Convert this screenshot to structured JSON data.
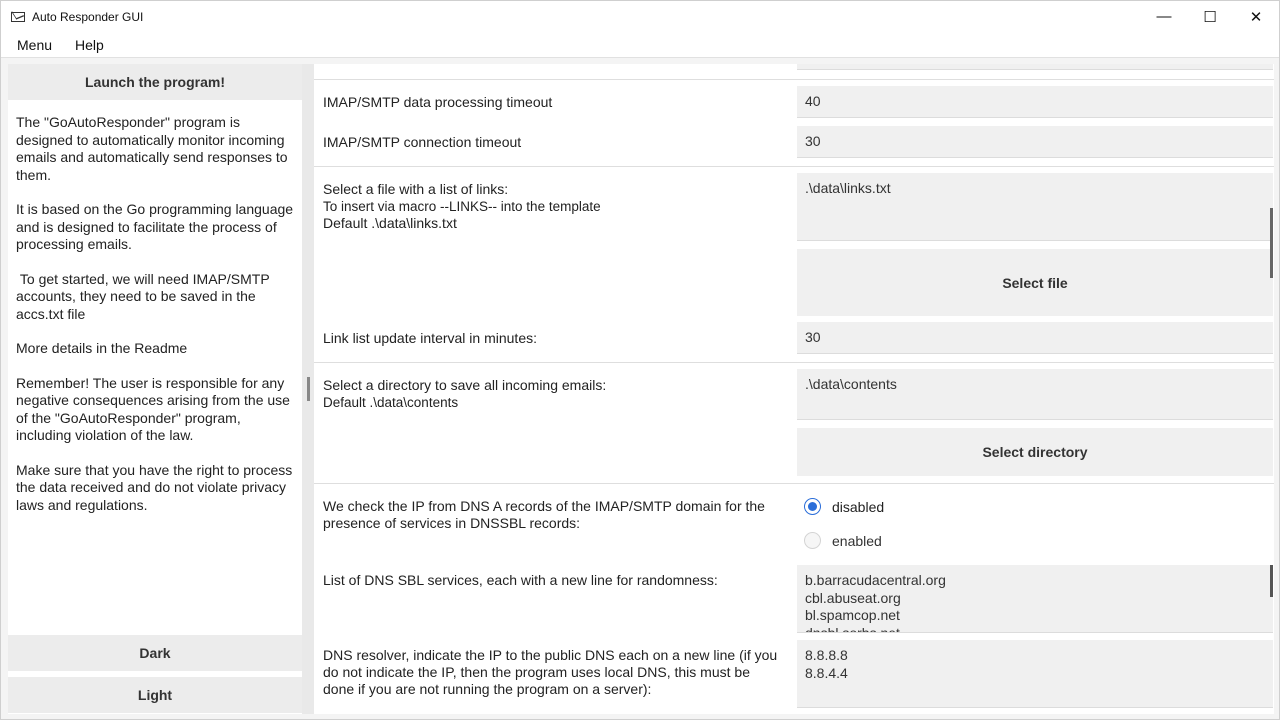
{
  "window": {
    "title": "Auto Responder GUI",
    "minimize": "—",
    "maximize": "☐",
    "close": "✕"
  },
  "menu": {
    "items": [
      "Menu",
      "Help"
    ]
  },
  "left": {
    "launch_label": "Launch the program!",
    "paragraphs": [
      "The \"GoAutoResponder\" program is designed to automatically monitor incoming emails and automatically send responses to them.",
      "It is based on the Go programming language and is designed to facilitate the process of processing emails.",
      " To get started, we will need IMAP/SMTP accounts, they need to be saved in the accs.txt file",
      "More details in the Readme",
      "Remember! The user is responsible for any negative consequences arising from the use of the \"GoAutoResponder\" program, including violation of the law.",
      "Make sure that you have the right to process the data received and do not violate privacy laws and regulations."
    ],
    "dark_label": "Dark",
    "light_label": "Light"
  },
  "settings": {
    "data_timeout": {
      "label": "IMAP/SMTP data processing timeout",
      "value": "40"
    },
    "conn_timeout": {
      "label": "IMAP/SMTP connection timeout",
      "value": "30"
    },
    "links_file": {
      "label": "Select a file with a list of links:",
      "hint1": "To insert via macro --LINKS-- into the template",
      "hint2": "Default .\\data\\links.txt",
      "value": ".\\data\\links.txt",
      "button": "Select file"
    },
    "link_interval": {
      "label": "Link list update interval in minutes:",
      "value": "30"
    },
    "contents_dir": {
      "label": "Select a directory to save all incoming emails:",
      "hint": "Default .\\data\\contents",
      "value": ".\\data\\contents",
      "button": "Select directory"
    },
    "dnssbl_check": {
      "label": "We check the IP from DNS A records of the IMAP/SMTP domain for the presence of services in DNSSBL records:",
      "option_disabled": "disabled",
      "option_enabled": "enabled"
    },
    "sbl_list": {
      "label": "List of DNS SBL services, each with a new line for randomness:",
      "lines": [
        "b.barracudacentral.org",
        "cbl.abuseat.org",
        "bl.spamcop.net",
        "dnsbl.sorbs.net"
      ]
    },
    "resolver": {
      "label": "DNS resolver, indicate the IP to the public DNS each on a new line (if you do not indicate the IP, then the program uses local DNS, this must be done if you are not running the program on a server):",
      "lines": [
        "8.8.8.8",
        "8.8.4.4"
      ]
    }
  }
}
